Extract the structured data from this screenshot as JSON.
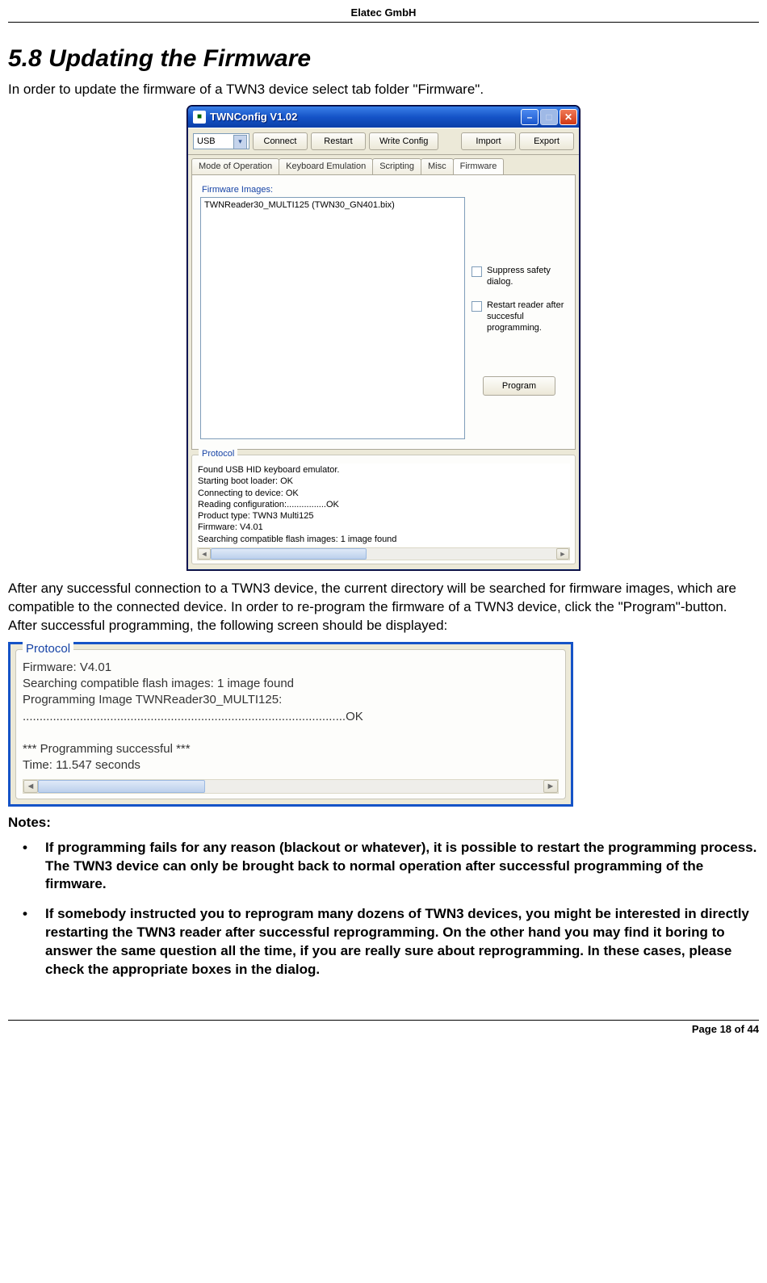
{
  "header": {
    "company": "Elatec GmbH"
  },
  "section": {
    "number": "5.8",
    "title": "Updating the Firmware",
    "intro": "In order to update the firmware of a TWN3 device select tab folder \"Firmware\"."
  },
  "win": {
    "title": "TWNConfig V1.02",
    "conn_select": "USB",
    "buttons": {
      "connect": "Connect",
      "restart": "Restart",
      "writecfg": "Write Config",
      "import": "Import",
      "export": "Export"
    },
    "tabs": [
      "Mode of Operation",
      "Keyboard Emulation",
      "Scripting",
      "Misc",
      "Firmware"
    ],
    "active_tab": 4,
    "fw": {
      "images_label": "Firmware Images:",
      "image_item": "TWNReader30_MULTI125 (TWN30_GN401.bix)",
      "suppress": "Suppress safety dialog.",
      "restart": "Restart reader after succesful programming.",
      "program_btn": "Program"
    },
    "protocol": {
      "label": "Protocol",
      "text": "Found USB HID keyboard emulator.\nStarting boot loader: OK\nConnecting to device: OK\nReading configuration:................OK\nProduct type: TWN3 Multi125\nFirmware: V4.01\nSearching compatible flash images: 1 image found"
    }
  },
  "para2": "After any successful connection to a TWN3 device, the current directory will be searched for firmware images, which are compatible to the connected device. In order to re-program the firmware of a TWN3 device, click the \"Program\"-button. After successful programming, the following screen should be displayed:",
  "protobig": {
    "label": "Protocol",
    "text": "Firmware: V4.01\nSearching compatible flash images: 1 image found\nProgramming Image TWNReader30_MULTI125:\n................................................................................................OK\n\n*** Programming successful ***\nTime: 11.547 seconds"
  },
  "notes": {
    "heading": "Notes:",
    "items": [
      "If programming fails for any reason (blackout or whatever), it is possible to restart the programming process. The TWN3 device can only be brought back to normal operation after successful programming of the firmware.",
      "If somebody instructed you to reprogram many dozens of TWN3 devices, you might be interested in directly restarting the TWN3 reader after successful reprogramming. On the other hand you may find it boring to answer the same question all the time, if you are really sure about reprogramming. In these cases, please check the appropriate boxes in the dialog."
    ]
  },
  "footer": {
    "page": "Page 18 of 44"
  }
}
